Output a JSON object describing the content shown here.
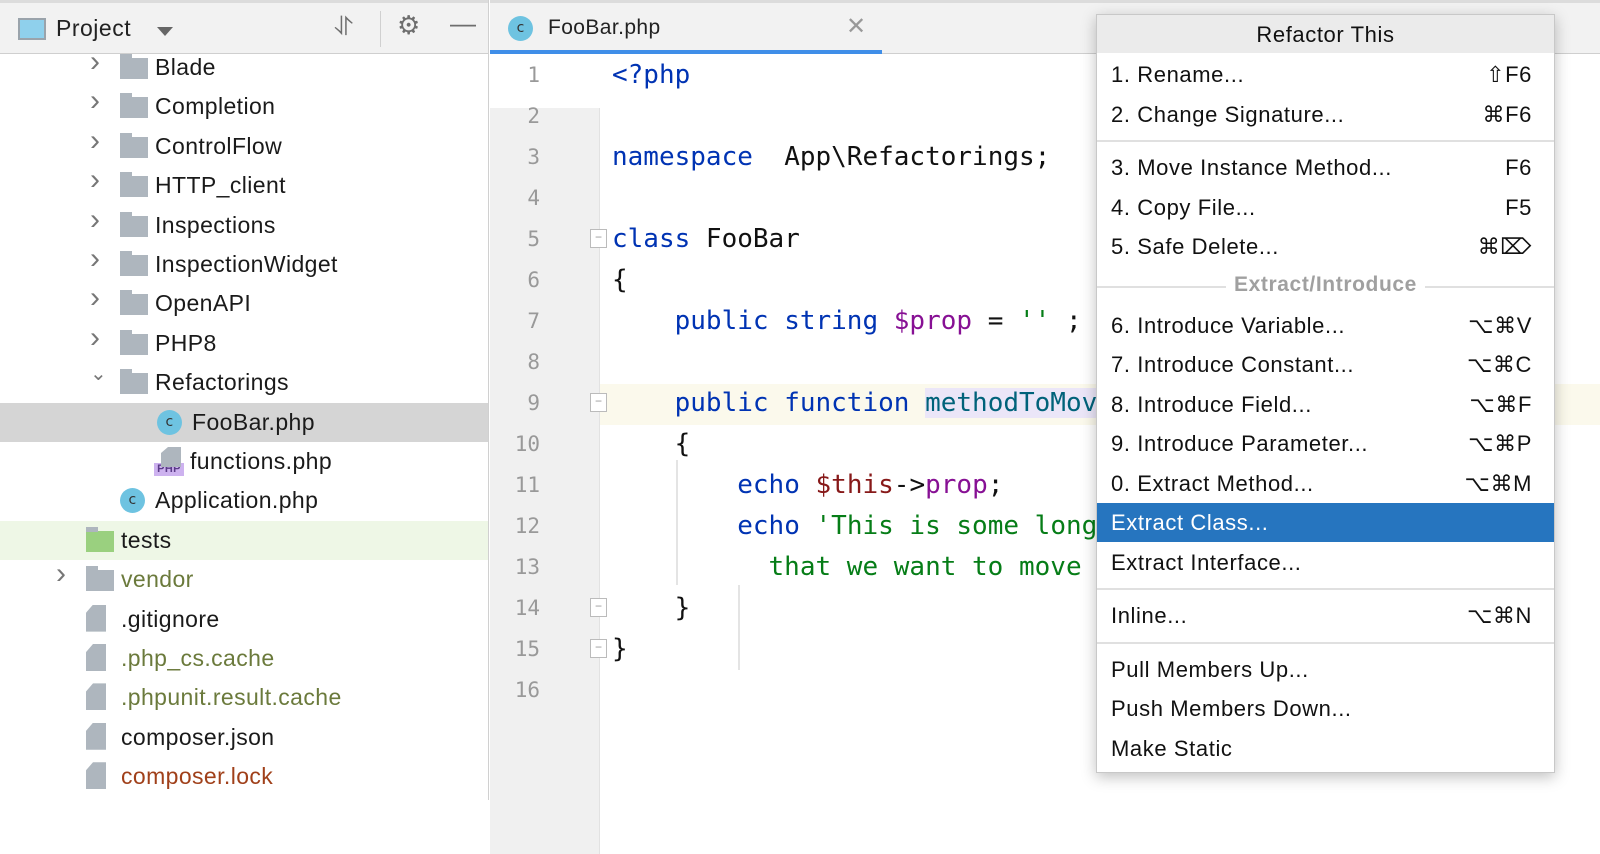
{
  "project": {
    "title": "Project",
    "tree": [
      {
        "label": "Blade",
        "kind": "folder",
        "indent": 2,
        "chevron": "closed"
      },
      {
        "label": "Completion",
        "kind": "folder",
        "indent": 2,
        "chevron": "closed"
      },
      {
        "label": "ControlFlow",
        "kind": "folder",
        "indent": 2,
        "chevron": "closed"
      },
      {
        "label": "HTTP_client",
        "kind": "folder",
        "indent": 2,
        "chevron": "closed"
      },
      {
        "label": "Inspections",
        "kind": "folder",
        "indent": 2,
        "chevron": "closed"
      },
      {
        "label": "InspectionWidget",
        "kind": "folder",
        "indent": 2,
        "chevron": "closed"
      },
      {
        "label": "OpenAPI",
        "kind": "folder",
        "indent": 2,
        "chevron": "closed"
      },
      {
        "label": "PHP8",
        "kind": "folder",
        "indent": 2,
        "chevron": "closed"
      },
      {
        "label": "Refactorings",
        "kind": "folder",
        "indent": 2,
        "chevron": "open"
      },
      {
        "label": "FooBar.php",
        "kind": "class",
        "indent": 3,
        "selected": true
      },
      {
        "label": "functions.php",
        "kind": "php",
        "indent": 3
      },
      {
        "label": "Application.php",
        "kind": "class",
        "indent": 2
      },
      {
        "label": "tests",
        "kind": "testfolder",
        "indent": 1,
        "highlight": true
      },
      {
        "label": "vendor",
        "kind": "folder",
        "indent": 1,
        "chevron": "closed",
        "color": "#6b7a3c"
      },
      {
        "label": ".gitignore",
        "kind": "ignore",
        "indent": 1
      },
      {
        "label": ".php_cs.cache",
        "kind": "text",
        "indent": 1,
        "color": "#6b7a3c"
      },
      {
        "label": ".phpunit.result.cache",
        "kind": "text",
        "indent": 1,
        "color": "#6b7a3c"
      },
      {
        "label": "composer.json",
        "kind": "json",
        "indent": 1
      },
      {
        "label": "composer.lock",
        "kind": "json",
        "indent": 1,
        "color": "#a0401a"
      }
    ]
  },
  "editor": {
    "tab": {
      "label": "FooBar.php",
      "icon": "class-icon"
    },
    "lines": [
      [
        [
          "k",
          "<?php"
        ]
      ],
      [],
      [
        [
          "k",
          "namespace"
        ],
        [
          "",
          "  App\\Refactorings;"
        ]
      ],
      [],
      [
        [
          "k",
          "class"
        ],
        [
          "",
          " FooBar"
        ]
      ],
      [
        [
          "",
          "{"
        ]
      ],
      [
        [
          "",
          "    "
        ],
        [
          "k",
          "public string "
        ],
        [
          "v",
          "$prop"
        ],
        [
          "",
          " = "
        ],
        [
          "s",
          "''"
        ],
        [
          ";",
          " ;"
        ]
      ],
      [],
      [
        [
          "",
          "    "
        ],
        [
          "k",
          "public function "
        ],
        [
          "fn hl-ident",
          "methodToMov"
        ]
      ],
      [
        [
          "",
          "    {"
        ]
      ],
      [
        [
          "",
          "        "
        ],
        [
          "k",
          "echo "
        ],
        [
          "this",
          "$this"
        ],
        [
          "",
          "->"
        ],
        [
          "v",
          "prop"
        ],
        [
          "",
          ";"
        ]
      ],
      [
        [
          "",
          "        "
        ],
        [
          "k",
          "echo "
        ],
        [
          "s",
          "'This is some long"
        ]
      ],
      [
        [
          "s",
          "          that we want to move"
        ]
      ],
      [
        [
          "",
          "    }"
        ]
      ],
      [
        [
          "",
          "}"
        ]
      ],
      []
    ]
  },
  "menu": {
    "title": "Refactor This",
    "group_label": "Extract/Introduce",
    "items": [
      {
        "label": "1. Rename...",
        "shortcut": "⇧F6"
      },
      {
        "label": "2. Change Signature...",
        "shortcut": "⌘F6"
      },
      {
        "label": "3. Move Instance Method...",
        "shortcut": "F6"
      },
      {
        "label": "4. Copy File...",
        "shortcut": "F5"
      },
      {
        "label": "5. Safe Delete...",
        "shortcut": "⌘⌦"
      },
      {
        "label": "6. Introduce Variable...",
        "shortcut": "⌥⌘V"
      },
      {
        "label": "7. Introduce Constant...",
        "shortcut": "⌥⌘C"
      },
      {
        "label": "8. Introduce Field...",
        "shortcut": "⌥⌘F"
      },
      {
        "label": "9. Introduce Parameter...",
        "shortcut": "⌥⌘P"
      },
      {
        "label": "0. Extract Method...",
        "shortcut": "⌥⌘M"
      },
      {
        "label": "Extract Class...",
        "shortcut": "",
        "selected": true
      },
      {
        "label": "Extract Interface...",
        "shortcut": ""
      },
      {
        "label": "Inline...",
        "shortcut": "⌥⌘N"
      },
      {
        "label": "Pull Members Up...",
        "shortcut": ""
      },
      {
        "label": "Push Members Down...",
        "shortcut": ""
      },
      {
        "label": "Make Static",
        "shortcut": ""
      }
    ]
  }
}
